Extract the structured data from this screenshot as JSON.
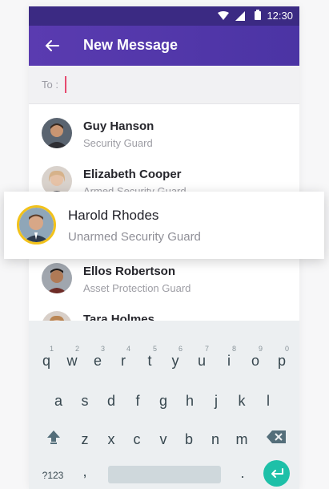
{
  "status_bar": {
    "time": "12:30"
  },
  "app_bar": {
    "title": "New Message"
  },
  "to_field": {
    "label": "To :"
  },
  "contacts": [
    {
      "name": "Guy Hanson",
      "role": "Security Guard"
    },
    {
      "name": "Elizabeth Cooper",
      "role": "Armed Security Guard"
    },
    {
      "name": "Harold Rhodes",
      "role": "Unarmed Security Guard"
    },
    {
      "name": "Ellos Robertson",
      "role": "Asset Protection Guard"
    },
    {
      "name": "Tara Holmes",
      "role": ""
    }
  ],
  "keyboard": {
    "row1": [
      {
        "ch": "q",
        "hint": "1"
      },
      {
        "ch": "w",
        "hint": "2"
      },
      {
        "ch": "e",
        "hint": "3"
      },
      {
        "ch": "r",
        "hint": "4"
      },
      {
        "ch": "t",
        "hint": "5"
      },
      {
        "ch": "y",
        "hint": "6"
      },
      {
        "ch": "u",
        "hint": "7"
      },
      {
        "ch": "i",
        "hint": "8"
      },
      {
        "ch": "o",
        "hint": "9"
      },
      {
        "ch": "p",
        "hint": "0"
      }
    ],
    "row2": [
      "a",
      "s",
      "d",
      "f",
      "g",
      "h",
      "j",
      "k",
      "l"
    ],
    "row3": [
      "z",
      "x",
      "c",
      "v",
      "b",
      "n",
      "m"
    ],
    "symbols_label": "?123",
    "comma": ",",
    "period": "."
  },
  "colors": {
    "app_bar": "#5a3bb0",
    "highlight_border": "#f2c21b",
    "enter_key": "#1ec0a8",
    "caret": "#e64a6f"
  }
}
